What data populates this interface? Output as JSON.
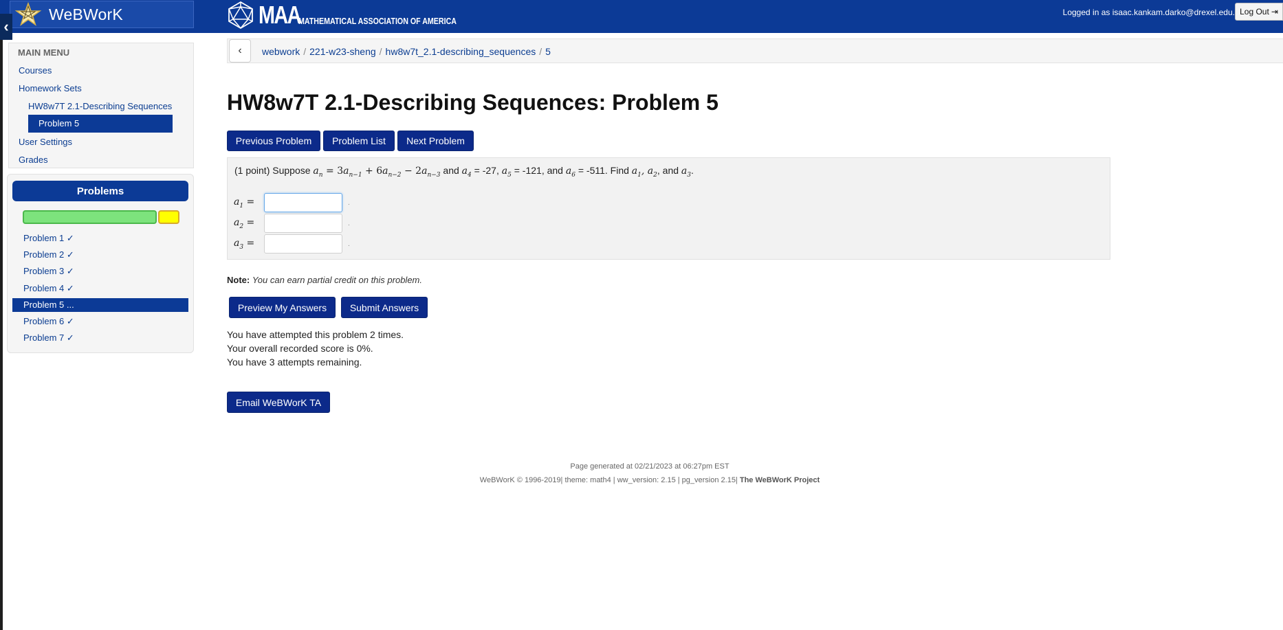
{
  "header": {
    "brand_name": "WeBWorK",
    "maa_big": "MAA",
    "maa_small": "MATHEMATICAL ASSOCIATION OF AMERICA",
    "login_text": "Logged in as isaac.kankam.darko@drexel.edu.",
    "logout_label": "Log Out"
  },
  "colors": {
    "brand_blue": "#0c3a96",
    "button_blue": "#0c2a8a",
    "progress_green": "#7de37d",
    "progress_yellow": "#ffff00"
  },
  "sidebar": {
    "main_menu_title": "MAIN MENU",
    "links": {
      "courses": "Courses",
      "homework_sets": "Homework Sets",
      "current_set": "HW8w7T 2.1-Describing Sequences",
      "current_problem": "Problem 5",
      "user_settings": "User Settings",
      "grades": "Grades"
    },
    "problems_title": "Problems",
    "progress": {
      "correct_fraction": 0.857,
      "attempted_fraction": 0.143
    },
    "problem_list": [
      {
        "label": "Problem 1 ✓",
        "status": "correct"
      },
      {
        "label": "Problem 2 ✓",
        "status": "correct"
      },
      {
        "label": "Problem 3 ✓",
        "status": "correct"
      },
      {
        "label": "Problem 4 ✓",
        "status": "correct"
      },
      {
        "label": "Problem 5 ...",
        "status": "current"
      },
      {
        "label": "Problem 6 ✓",
        "status": "correct"
      },
      {
        "label": "Problem 7 ✓",
        "status": "correct"
      }
    ]
  },
  "breadcrumb": {
    "items": [
      "webwork",
      "221-w23-sheng",
      "hw8w7t_2.1-describing_sequences",
      "5"
    ],
    "separator": "/"
  },
  "page": {
    "title": "HW8w7T 2.1-Describing Sequences: Problem 5",
    "buttons": {
      "previous": "Previous Problem",
      "list": "Problem List",
      "next": "Next Problem"
    }
  },
  "problem": {
    "points": "(1 point)",
    "suppose": "Suppose",
    "and1": "and",
    "a4_value": "= -27,",
    "a5_value": "= -121, and",
    "a6_value": "= -511. Find",
    "find_and": ", and",
    "answers": [
      {
        "label_sub": "1",
        "value": ""
      },
      {
        "label_sub": "2",
        "value": ""
      },
      {
        "label_sub": "3",
        "value": ""
      }
    ],
    "answer_dot": "."
  },
  "note": {
    "label": "Note:",
    "text": "You can earn partial credit on this problem."
  },
  "actions": {
    "preview": "Preview My Answers",
    "submit": "Submit Answers",
    "email": "Email WeBWorK TA"
  },
  "attempts": {
    "line1": "You have attempted this problem 2 times.",
    "line2": "Your overall recorded score is 0%.",
    "line3": "You have 3 attempts remaining."
  },
  "footer": {
    "generated": "Page generated at 02/21/2023 at 06:27pm EST",
    "copyright": "WeBWorK © 1996-2019| theme: math4 | ww_version: 2.15 | pg_version 2.15|",
    "project": "The WeBWorK Project"
  }
}
